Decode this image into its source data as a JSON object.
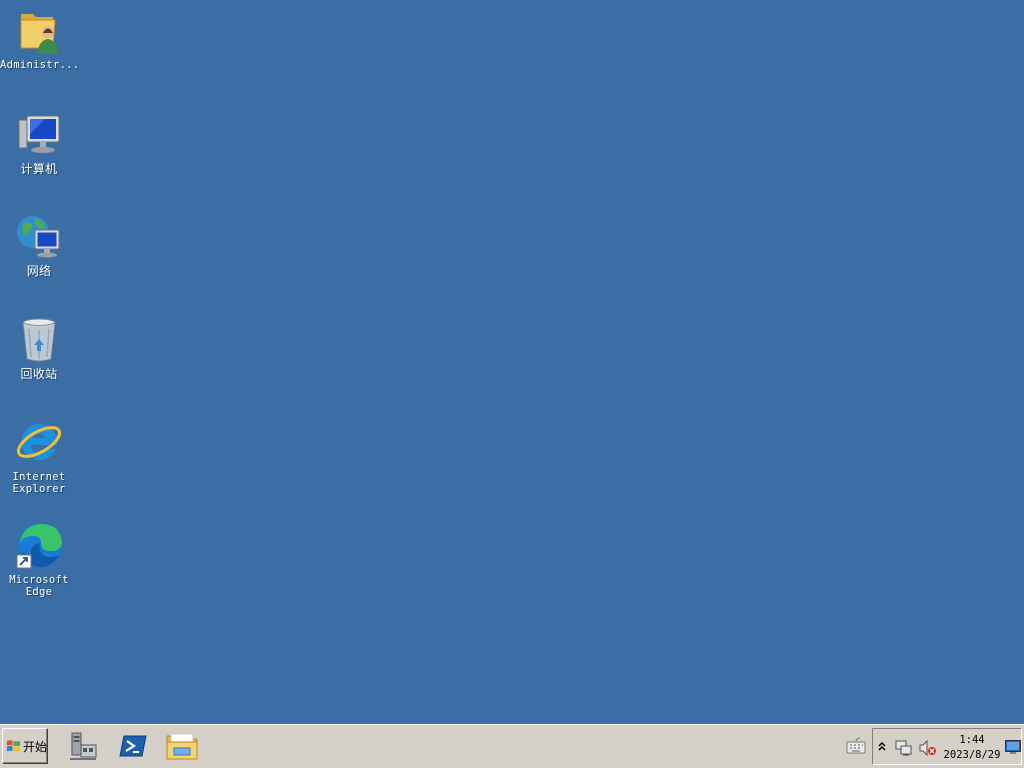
{
  "desktop": {
    "background": "#3a6ea5",
    "icons": [
      {
        "label": "Administr...",
        "icon": "user-folder-icon"
      },
      {
        "label": "计算机",
        "icon": "computer-icon"
      },
      {
        "label": "网络",
        "icon": "network-icon"
      },
      {
        "label": "回收站",
        "icon": "recycle-bin-icon"
      },
      {
        "label": "Internet\nExplorer",
        "icon": "internet-explorer-icon"
      },
      {
        "label": "Microsoft\nEdge",
        "icon": "microsoft-edge-icon"
      }
    ]
  },
  "taskbar": {
    "background": "#d4d0c8",
    "start_label": "开始",
    "pinned": [
      {
        "icon": "server-manager-icon"
      },
      {
        "icon": "powershell-icon"
      },
      {
        "icon": "file-explorer-icon"
      }
    ],
    "tray": {
      "keyboard_icon": "keyboard-icon",
      "chevron_icon": "chevron-up-icon",
      "network_icon": "network-status-icon",
      "volume_icon": "volume-muted-icon",
      "time": "1:44",
      "date": "2023/8/29",
      "show_desktop_icon": "show-desktop-icon"
    }
  }
}
